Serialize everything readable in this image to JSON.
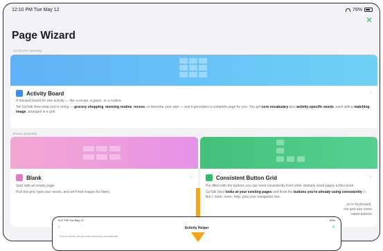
{
  "status": {
    "time": "12:10 PM  Tue May 12",
    "battery": "76%"
  },
  "page": {
    "title": "Page Wizard",
    "close_icon": "✕"
  },
  "activity_section": {
    "label": "ACTIVITY BOARD"
  },
  "activity_card": {
    "title": "Activity Board",
    "subtitle": "A focused board for one activity — like a recipe, a game, or a routine.",
    "desc_1": "Tell GoTalk Now what you're doing —",
    "desc_b1": "grocery shopping",
    "desc_2": ",",
    "desc_b2": "morning routine",
    "desc_3": ",",
    "desc_b3": "recess",
    "desc_4": ", or describe your own — and it generates a complete page for you. You get",
    "desc_b4": "core vocabulary",
    "desc_5": "plus",
    "desc_b5": "activity-specific words",
    "desc_6": ", each with a",
    "desc_b6": "matching image",
    "desc_7": ", arranged in a grid.",
    "color": "#5aa9f5"
  },
  "wizard_section": {
    "label": "PAGE WIZARD"
  },
  "blank_card": {
    "title": "Blank",
    "line1": "Start with an empty page.",
    "line2": "Pick the grid, type your words, and we'll find images for them.",
    "color": "#f09bd8"
  },
  "consistent_card": {
    "title": "Consistent Button Grid",
    "line1": "Pre-filled with the buttons you use most consistently from other similarly sized pages in this book",
    "desc_1": "GoTalk Now",
    "desc_b1": "looks at your existing pages",
    "desc_2": "and finds the",
    "desc_b2": "buttons you're already using consistently",
    "desc_3": "— like I, want, more, help, plus your navigation row.",
    "desc_tail_1": "ne in Keyboard).",
    "desc_tail_2": "me grid size come",
    "desc_tail_3": "nated buttons",
    "color": "#3ec77a"
  },
  "inset": {
    "time": "3:07 PM  Tue May 12",
    "battery": "69%",
    "title": "Activity Helper",
    "body": "Pick an activity and generate vocabulary automatically."
  },
  "colors": {
    "accent_green": "#34c759",
    "arrow": "#f4a51c"
  }
}
